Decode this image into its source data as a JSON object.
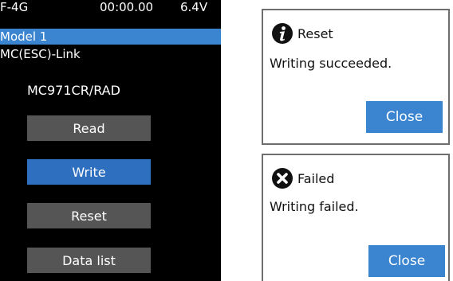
{
  "screen": {
    "status": {
      "model_type": "F-4G",
      "timer": "00:00.00",
      "voltage": "6.4V"
    },
    "model_name": "Model 1",
    "title": "MC(ESC)-Link",
    "device": "MC971CR/RAD",
    "buttons": {
      "read": "Read",
      "write": "Write",
      "reset": "Reset",
      "data_list": "Data list"
    },
    "selected_button": "write"
  },
  "dialogs": {
    "success": {
      "icon": "info-icon",
      "title": "Reset",
      "message": "Writing succeeded.",
      "close_label": "Close"
    },
    "failure": {
      "icon": "error-icon",
      "title": "Failed",
      "message": "Writing failed.",
      "close_label": "Close"
    }
  },
  "colors": {
    "accent": "#3a84d0",
    "selected_button": "#2f6fc0",
    "button": "#555555",
    "screen_bg": "#000000"
  }
}
